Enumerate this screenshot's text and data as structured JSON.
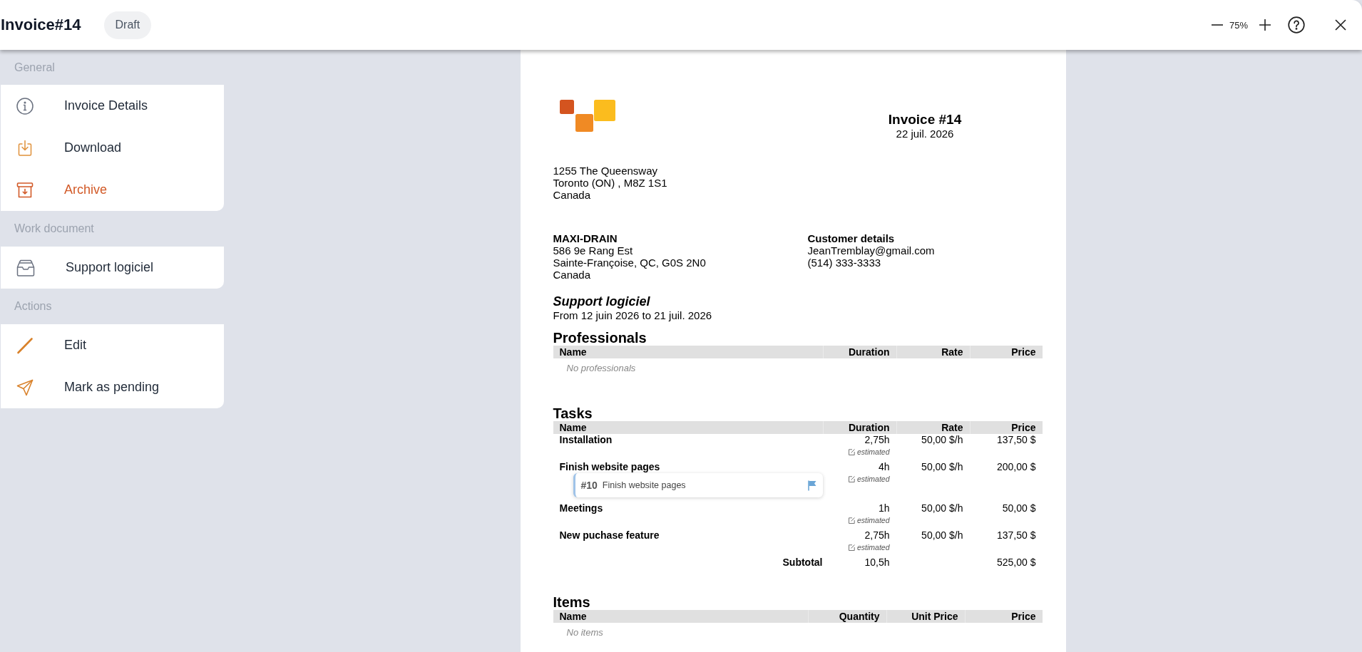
{
  "header": {
    "title": "Invoice#14",
    "status": "Draft",
    "zoom": "75%"
  },
  "sidebar": {
    "sections": [
      {
        "label": "General",
        "items": [
          {
            "label": "Invoice Details",
            "kind": "normal"
          },
          {
            "label": "Download",
            "kind": "normal"
          },
          {
            "label": "Archive",
            "kind": "danger"
          }
        ]
      },
      {
        "label": "Work document",
        "items": [
          {
            "label": "Support logiciel",
            "kind": "normal"
          }
        ]
      },
      {
        "label": "Actions",
        "items": [
          {
            "label": "Edit",
            "kind": "normal"
          },
          {
            "label": "Mark as pending",
            "kind": "normal"
          }
        ]
      }
    ]
  },
  "document": {
    "title": "Invoice #14",
    "date": "22 juil. 2026",
    "company_address": [
      "1255 The Queensway",
      "Toronto (ON) , M8Z 1S1",
      "Canada"
    ],
    "client": {
      "name": "MAXI-DRAIN",
      "lines": [
        "586 9e Rang Est",
        "Sainte-Françoise, QC, G0S 2N0",
        "Canada"
      ]
    },
    "customer": {
      "heading": "Customer details",
      "lines": [
        "JeanTremblay@gmail.com",
        "(514) 333-3333"
      ]
    },
    "project": {
      "name": "Support logiciel",
      "period": "From 12 juin 2026 to 21 juil. 2026"
    },
    "sections": [
      {
        "title": "Professionals",
        "kind": "time",
        "columns": [
          "Name",
          "Duration",
          "Rate",
          "Price"
        ],
        "empty": "No professionals"
      },
      {
        "title": "Tasks",
        "kind": "time",
        "columns": [
          "Name",
          "Duration",
          "Rate",
          "Price"
        ],
        "rows": [
          {
            "name": "Installation",
            "duration": "2,75h",
            "note": "estimated",
            "rate": "50,00 $/h",
            "price": "137,50 $"
          },
          {
            "name": "Finish website pages",
            "linked_task": {
              "number": "#10",
              "title": "Finish website pages"
            },
            "duration": "4h",
            "note": "estimated",
            "rate": "50,00 $/h",
            "price": "200,00 $"
          },
          {
            "name": "Meetings",
            "duration": "1h",
            "note": "estimated",
            "rate": "50,00 $/h",
            "price": "50,00 $"
          },
          {
            "name": "New puchase feature",
            "duration": "2,75h",
            "note": "estimated",
            "rate": "50,00 $/h",
            "price": "137,50 $"
          }
        ],
        "subtotal": {
          "label": "Subtotal",
          "duration": "10,5h",
          "price": "525,00 $"
        }
      },
      {
        "title": "Items",
        "kind": "items",
        "columns": [
          "Name",
          "Quantity",
          "Unit Price",
          "Price"
        ],
        "empty": "No items"
      }
    ]
  }
}
